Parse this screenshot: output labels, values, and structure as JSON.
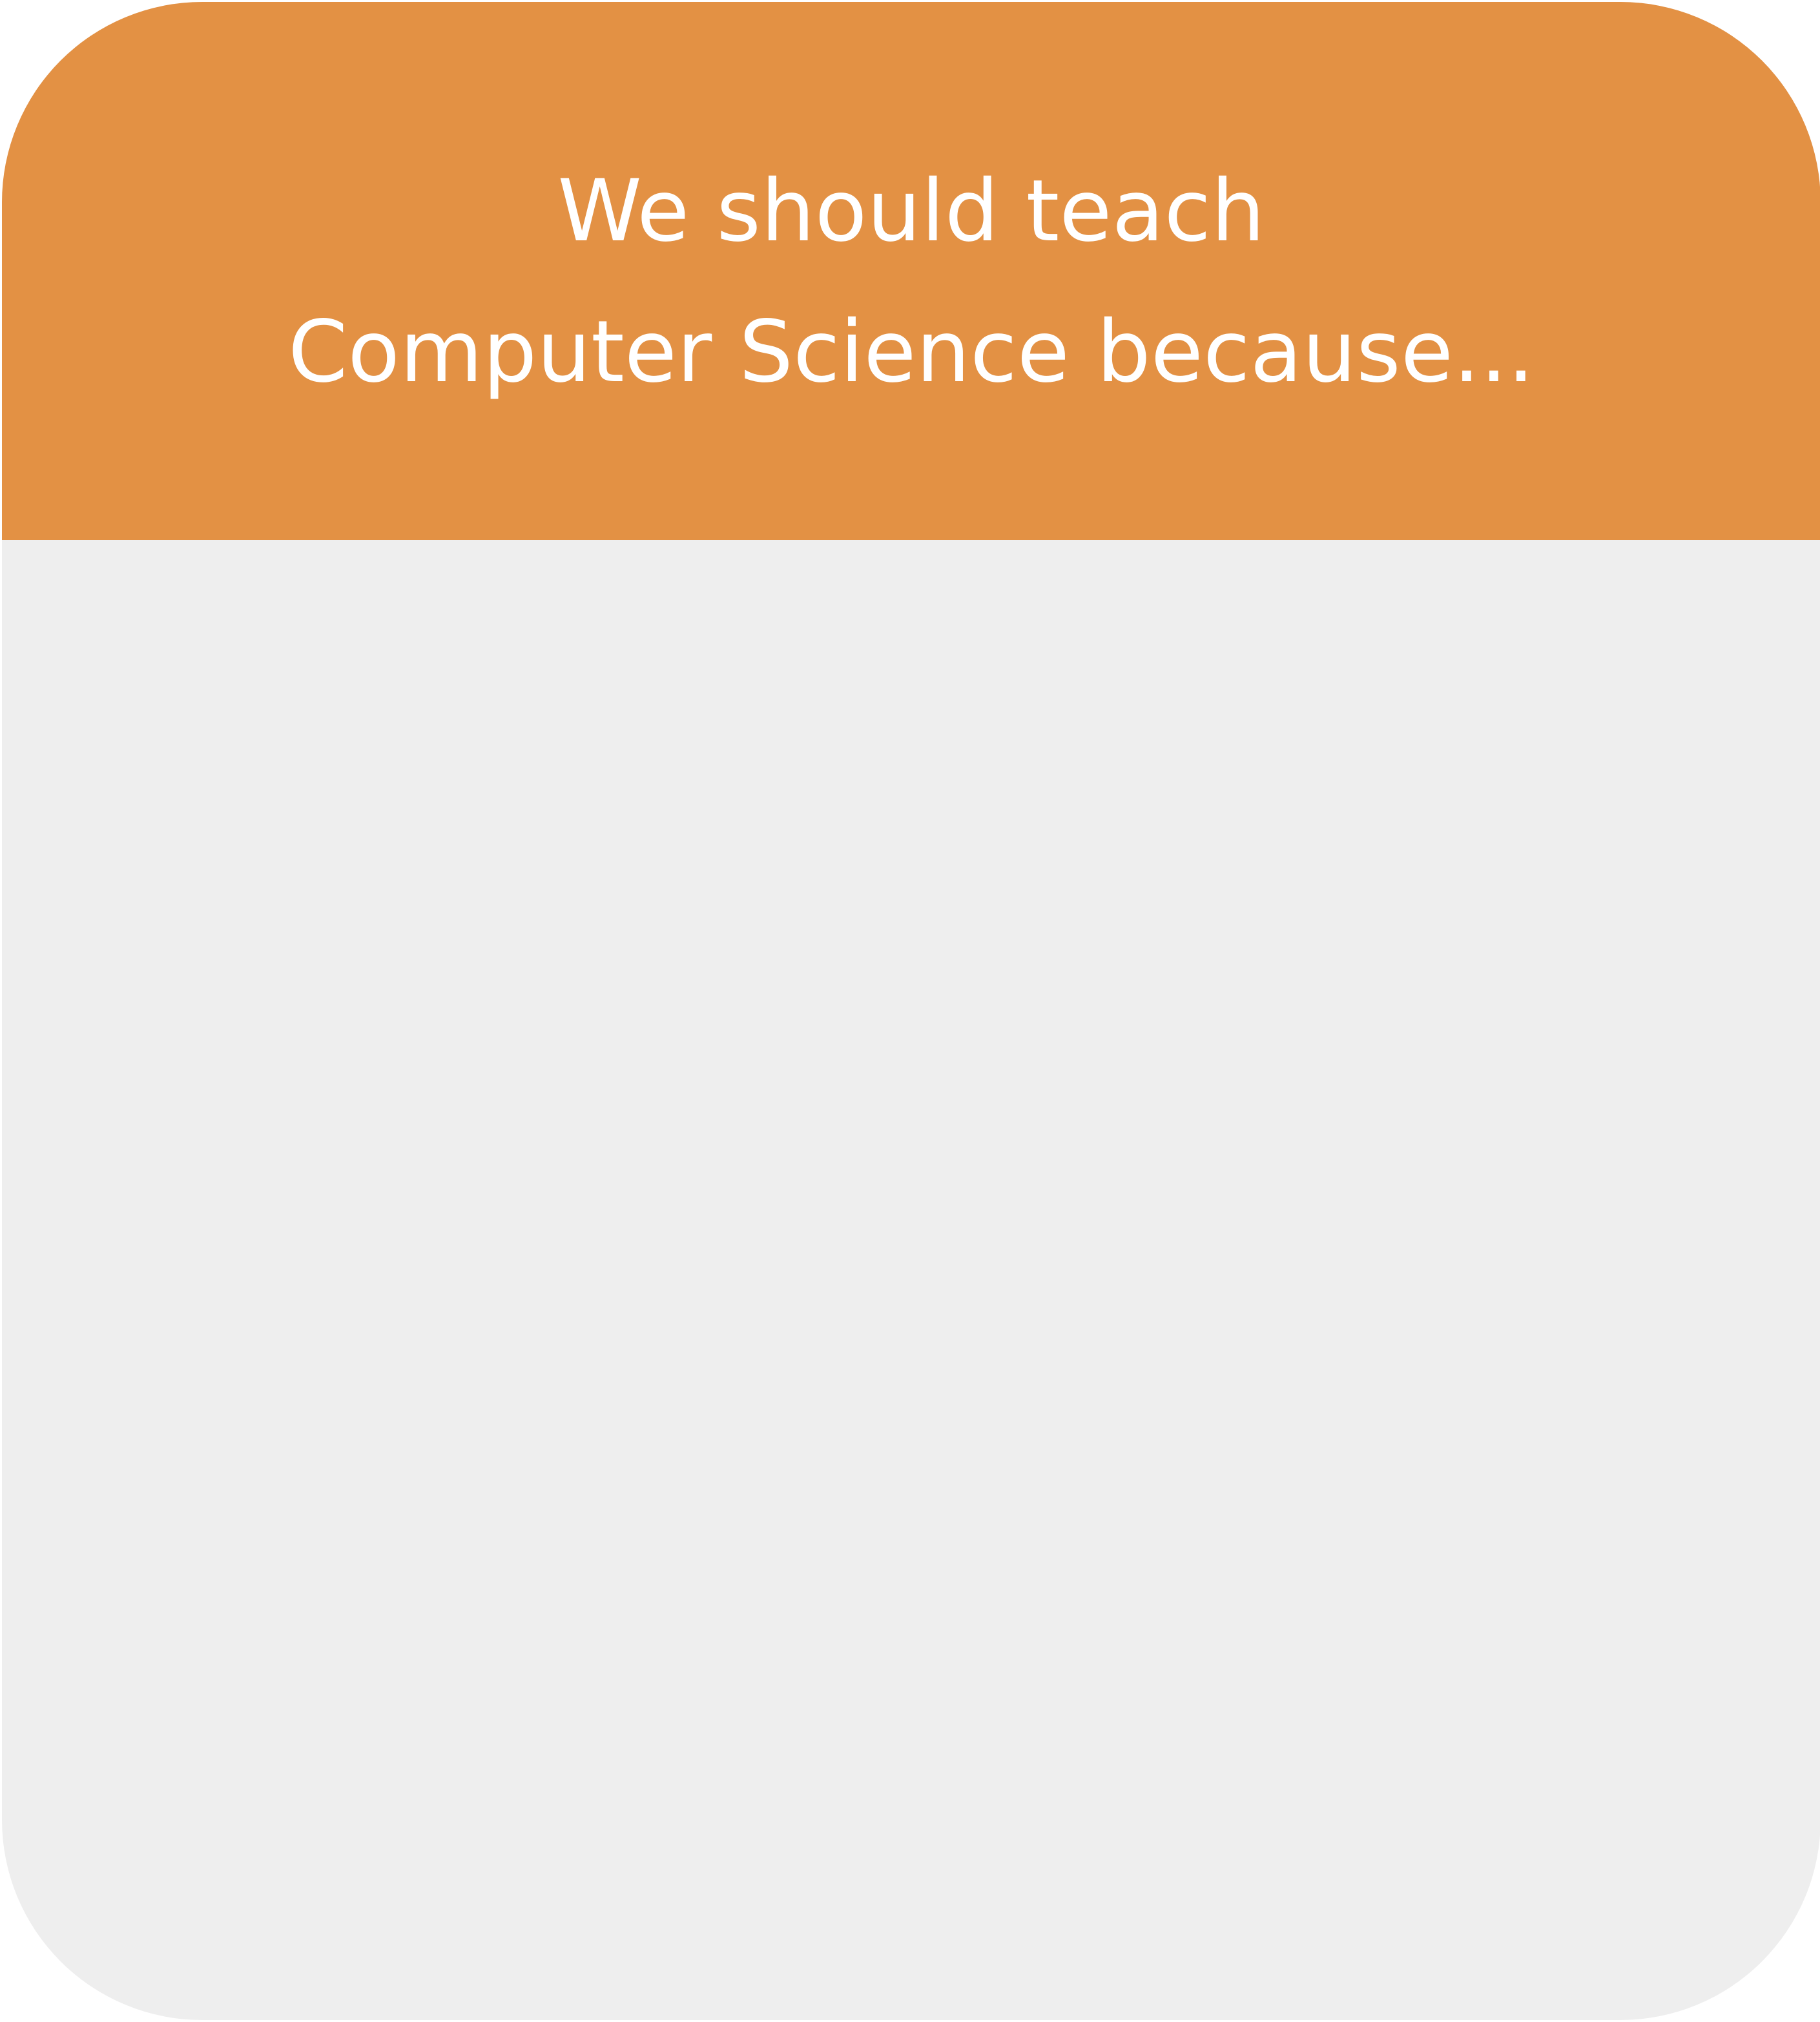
{
  "card": {
    "title_lines": [
      "We should teach",
      "Computer Science because..."
    ],
    "colors": {
      "header": "#E39144",
      "body": "#EEEEEE",
      "text": "#FFFFFF"
    }
  }
}
